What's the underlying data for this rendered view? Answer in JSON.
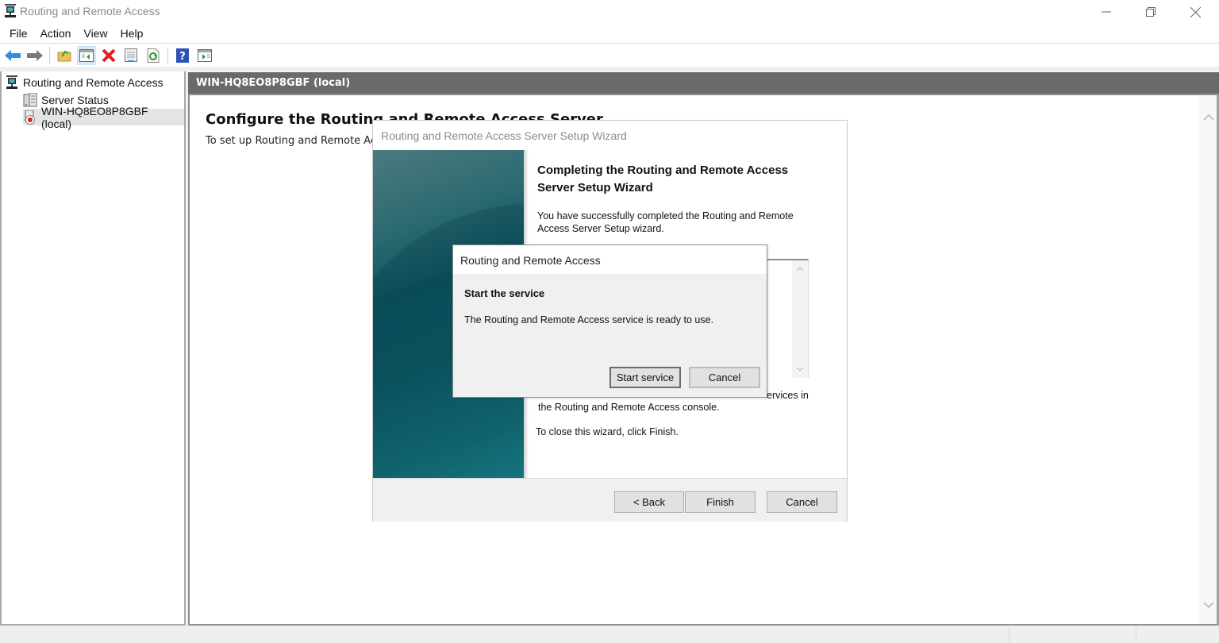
{
  "window": {
    "title": "Routing and Remote Access",
    "controls": {
      "minimize": "minimize",
      "restore": "restore",
      "close": "close"
    }
  },
  "menu": [
    "File",
    "Action",
    "View",
    "Help"
  ],
  "toolbar": {
    "buttons": [
      {
        "icon": "back-arrow-icon"
      },
      {
        "icon": "forward-arrow-icon"
      },
      {
        "icon": "up-folder-icon"
      },
      {
        "icon": "show-hide-console-tree-icon",
        "active": true
      },
      {
        "icon": "delete-icon"
      },
      {
        "icon": "properties-icon"
      },
      {
        "icon": "refresh-icon"
      },
      {
        "icon": "help-icon"
      },
      {
        "icon": "show-action-pane-icon"
      }
    ]
  },
  "tree": {
    "root": "Routing and Remote Access",
    "children": [
      {
        "label": "Server Status",
        "selected": false
      },
      {
        "label": "WIN-HQ8EO8P8GBF (local)",
        "selected": true
      }
    ]
  },
  "right_pane": {
    "header": "WIN-HQ8EO8P8GBF (local)",
    "heading": "Configure the Routing and Remote Access Server",
    "subtext": "To set up Routing and Remote Access"
  },
  "wizard": {
    "title": "Routing and Remote Access Server Setup Wizard",
    "heading": "Completing the Routing and Remote Access Server Setup Wizard",
    "intro": "You have successfully completed the Routing and Remote Access Server Setup wizard.",
    "partial_line_1": "ervices in",
    "partial_line_2": "the Routing and  Remote Access console.",
    "close_hint": "To close this wizard, click Finish.",
    "buttons": {
      "back": "< Back",
      "finish": "Finish",
      "cancel": "Cancel"
    }
  },
  "dialog": {
    "title": "Routing and Remote Access",
    "heading": "Start the service",
    "message": "The Routing and Remote Access service is ready to use.",
    "buttons": {
      "start": "Start service",
      "cancel": "Cancel"
    }
  }
}
